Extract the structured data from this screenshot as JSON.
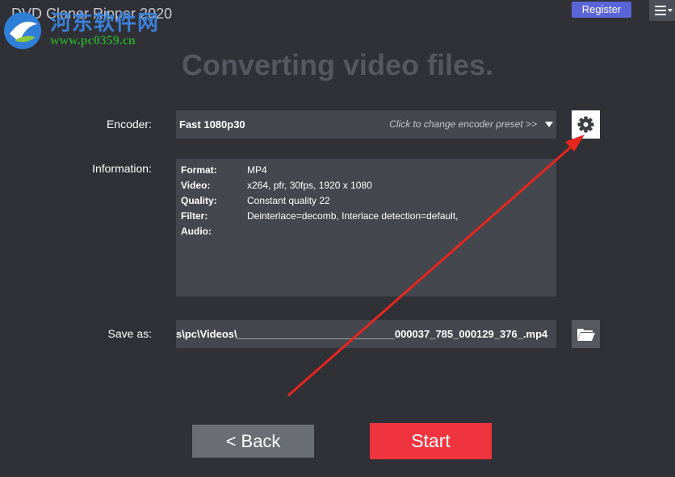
{
  "window": {
    "title": "DVD Cloner Ripper 2020",
    "register_label": "Register",
    "menu_icon": "hamburger-menu-icon"
  },
  "watermark": {
    "name": "河东软件网",
    "url": "www.pc0359.cn"
  },
  "heading": "Converting video files.",
  "encoder": {
    "label": "Encoder:",
    "value": "Fast 1080p30",
    "hint": "Click to change encoder preset >>",
    "settings_icon": "gear-icon"
  },
  "information": {
    "label": "Information:",
    "rows": [
      {
        "key": "Format:",
        "value": "MP4"
      },
      {
        "key": "Video:",
        "value": "x264, pfr, 30fps, 1920 x 1080"
      },
      {
        "key": "Quality:",
        "value": "Constant quality 22"
      },
      {
        "key": "Filter:",
        "value": "Deinterlace=decomb, Interlace detection=default,"
      },
      {
        "key": "Audio:",
        "value": ""
      }
    ]
  },
  "save_as": {
    "label": "Save as:",
    "path": "s\\pc\\Videos\\___________________________000037_785_000129_376_.mp4",
    "browse_icon": "folder-open-icon"
  },
  "buttons": {
    "back": "<  Back",
    "start": "Start"
  },
  "colors": {
    "background": "#2f3137",
    "panel": "#44474e",
    "register": "#5a65d8",
    "start": "#f0343f",
    "back": "#6a6d74",
    "annotation_arrow": "#e8261e"
  }
}
